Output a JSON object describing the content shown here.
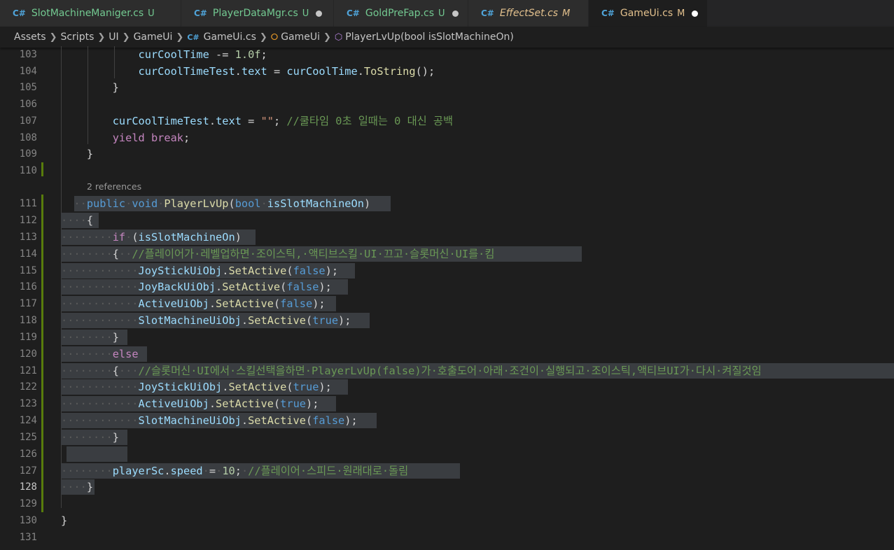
{
  "tabs": [
    {
      "icon": "C#",
      "name": "SlotMachineManiger.cs",
      "status": "U",
      "dot": false,
      "italic": false,
      "active": false
    },
    {
      "icon": "C#",
      "name": "PlayerDataMgr.cs",
      "status": "U",
      "dot": true,
      "italic": false,
      "active": false
    },
    {
      "icon": "C#",
      "name": "GoldPreFap.cs",
      "status": "U",
      "dot": true,
      "italic": false,
      "active": false
    },
    {
      "icon": "C#",
      "name": "EffectSet.cs",
      "status": "M",
      "dot": false,
      "italic": true,
      "active": false
    },
    {
      "icon": "C#",
      "name": "GameUi.cs",
      "status": "M",
      "dot": true,
      "italic": false,
      "active": true
    }
  ],
  "breadcrumb": {
    "assets": "Assets",
    "scripts": "Scripts",
    "ui": "UI",
    "gameui_folder": "GameUi",
    "file_icon": "C#",
    "file": "GameUi.cs",
    "class_name": "GameUi",
    "method": "PlayerLvUp(bool isSlotMachineOn)"
  },
  "editor": {
    "codelens": "2 references",
    "lines": [
      {
        "n": "103",
        "text": "            curCoolTime -= 1.0f;"
      },
      {
        "n": "104",
        "text": "            curCoolTimeTest.text = curCoolTime.ToString();"
      },
      {
        "n": "105",
        "text": "        }"
      },
      {
        "n": "106",
        "text": ""
      },
      {
        "n": "107",
        "text": "        curCoolTimeTest.text = \"\"; //쿨타임 0초 일때는 0 대신 공백"
      },
      {
        "n": "108",
        "text": "        yield break;"
      },
      {
        "n": "109",
        "text": "    }"
      },
      {
        "n": "110",
        "text": ""
      },
      {
        "n": "111",
        "text": "    public void PlayerLvUp(bool isSlotMachineOn)"
      },
      {
        "n": "112",
        "text": "    {"
      },
      {
        "n": "113",
        "text": "        if (isSlotMachineOn)"
      },
      {
        "n": "114",
        "text": "        {  //플레이어가 레벨업하면 조이스틱, 액티브스킬 UI 끄고 슬롯머신 UI를 킴"
      },
      {
        "n": "115",
        "text": "            JoyStickUiObj.SetActive(false);"
      },
      {
        "n": "116",
        "text": "            JoyBackUiObj.SetActive(false);"
      },
      {
        "n": "117",
        "text": "            ActiveUiObj.SetActive(false);"
      },
      {
        "n": "118",
        "text": "            SlotMachineUiObj.SetActive(true);"
      },
      {
        "n": "119",
        "text": "        }"
      },
      {
        "n": "120",
        "text": "        else"
      },
      {
        "n": "121",
        "text": "        {   //슬롯머신 UI에서 스킬선택을하면 PlayerLvUp(false)가 호출도어 아래 조건이 실행되고 조이스틱,액티브UI가 다시 켜질것임"
      },
      {
        "n": "122",
        "text": "            JoyStickUiObj.SetActive(true);"
      },
      {
        "n": "123",
        "text": "            ActiveUiObj.SetActive(true);"
      },
      {
        "n": "124",
        "text": "            SlotMachineUiObj.SetActive(false);"
      },
      {
        "n": "125",
        "text": "        }"
      },
      {
        "n": "126",
        "text": ""
      },
      {
        "n": "127",
        "text": "        playerSc.speed = 10; //플레이어 스피드 원래대로 돌림"
      },
      {
        "n": "128",
        "text": "    }"
      },
      {
        "n": "129",
        "text": ""
      },
      {
        "n": "130",
        "text": "}"
      },
      {
        "n": "131",
        "text": ""
      }
    ]
  },
  "colors": {
    "background": "#1e1e1e",
    "keyword": "#569cd6",
    "control": "#c586c0",
    "method": "#dcdcaa",
    "comment": "#6a9955",
    "string": "#ce9178",
    "number": "#b5cea8",
    "selection": "#3a3d41",
    "git_modified_bar": "#587c0c"
  }
}
